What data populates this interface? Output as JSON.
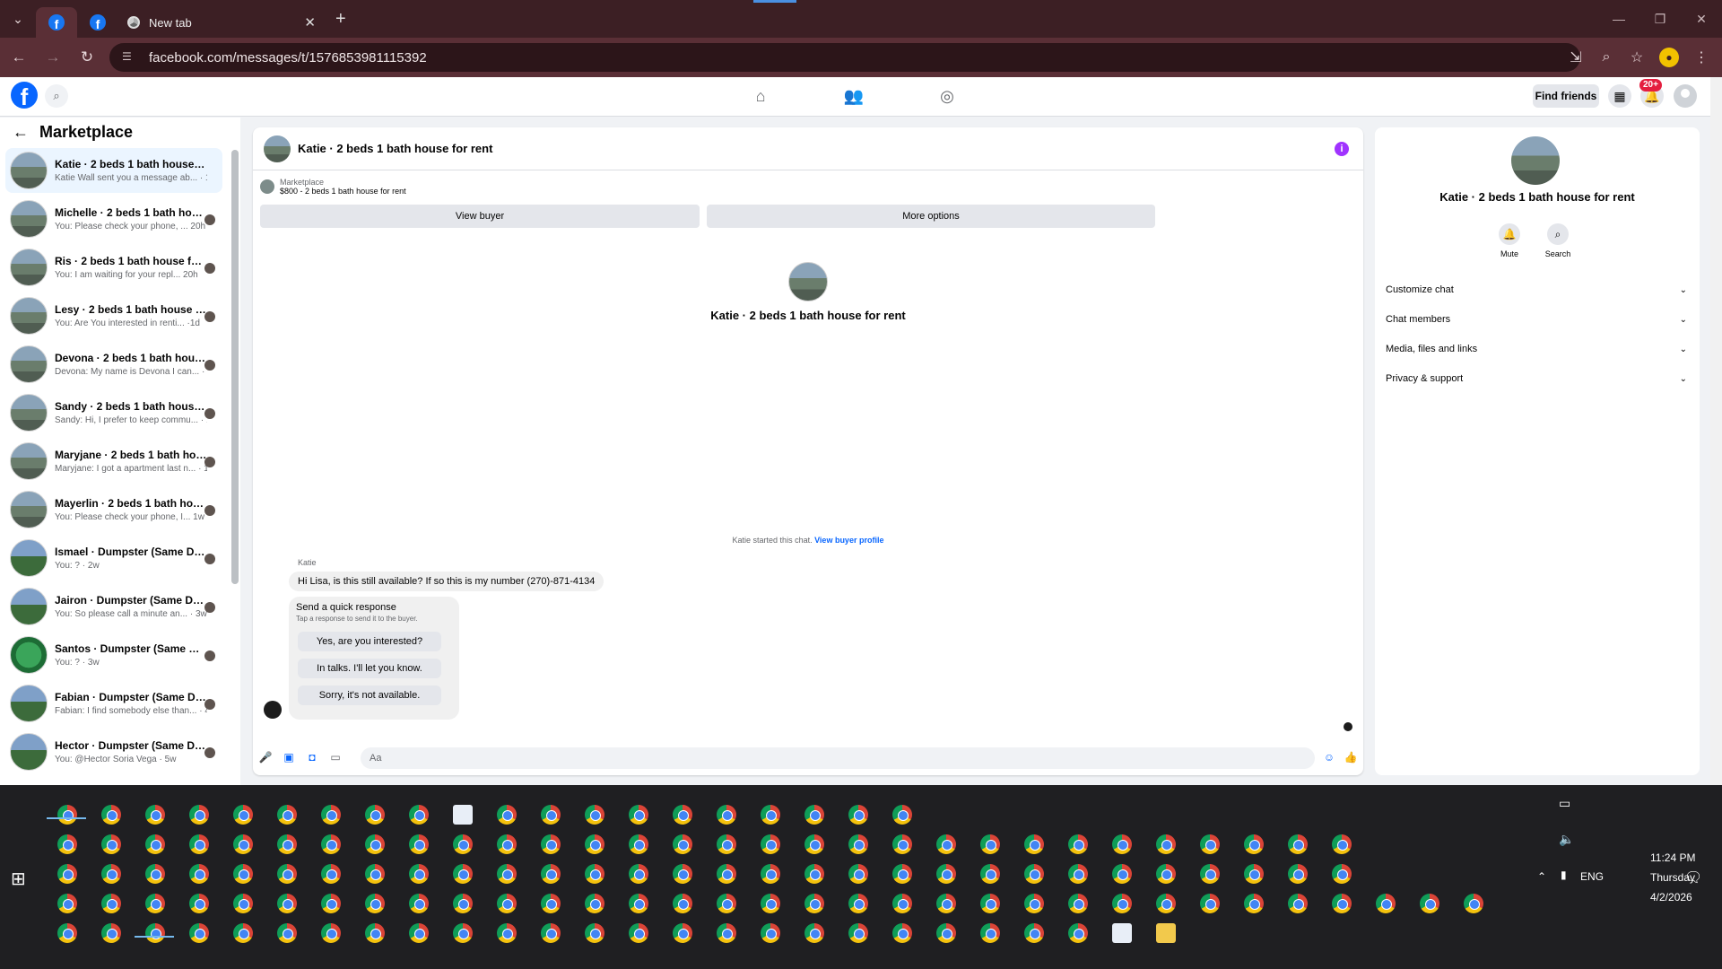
{
  "browser": {
    "new_tab_label": "New tab",
    "url": "facebook.com/messages/t/1576853981115392"
  },
  "header": {
    "find_friends_label": "Find friends",
    "notif_count": "20+"
  },
  "sidebar": {
    "title": "Marketplace",
    "conversations": [
      {
        "name": "Katie · 2 beds 1 bath house for r...",
        "preview": "Katie Wall sent you a message ab... · 19h"
      },
      {
        "name": "Michelle · 2 beds 1 bath hous...",
        "preview": "You: Please check your phone, ... 20h"
      },
      {
        "name": "Ris · 2 beds 1 bath house for ...",
        "preview": "You: I am waiting for your repl... 20h"
      },
      {
        "name": "Lesy · 2 beds 1 bath house fo...",
        "preview": "You: Are You interested in renti... ·1d"
      },
      {
        "name": "Devona · 2 beds 1 bath house f...",
        "preview": "Devona: My name is Devona I can... · 1w"
      },
      {
        "name": "Sandy · 2 beds 1 bath house for...",
        "preview": "Sandy: Hi, I prefer to keep commu... · 1w"
      },
      {
        "name": "Maryjane · 2 beds 1 bath house ...",
        "preview": "Maryjane: I got a apartment last n... · 1w"
      },
      {
        "name": "Mayerlin · 2 beds 1 bath hous...",
        "preview": "You: Please check your phone, I... 1w"
      },
      {
        "name": "Ismael · Dumpster (Same Day...",
        "preview": "You: ? · 2w"
      },
      {
        "name": "Jairon · Dumpster (Same Day...",
        "preview": "You: So please call a minute an... · 3w"
      },
      {
        "name": "Santos · Dumpster (Same Da...",
        "preview": "You: ? · 3w"
      },
      {
        "name": "Fabian · Dumpster (Same Day), ...",
        "preview": "Fabian: I find somebody else than... · 4w"
      },
      {
        "name": "Hector · Dumpster (Same Da...",
        "preview": "You: @Hector Soria Vega · 5w"
      }
    ]
  },
  "chat": {
    "title": "Katie · 2 beds 1 bath house for rent",
    "marketplace_label": "Marketplace",
    "listing": "$800 - 2 beds 1 bath house for rent",
    "view_buyer_label": "View buyer",
    "more_options_label": "More options",
    "center_title": "Katie · 2 beds 1 bath house for rent",
    "started_text": "Katie started this chat.",
    "view_profile_link": "View buyer profile",
    "sender_name": "Katie",
    "message": "Hi Lisa, is this still available? If so this is my number (270)-871-4134",
    "quick_title": "Send a quick response",
    "quick_sub": "Tap a response to send it to the buyer.",
    "quick_responses": [
      "Yes, are you interested?",
      "In talks. I'll let you know.",
      "Sorry, it's not available."
    ],
    "input_placeholder": "Aa"
  },
  "panel": {
    "title": "Katie · 2 beds 1 bath house for rent",
    "mute_label": "Mute",
    "search_label": "Search",
    "rows": [
      "Customize chat",
      "Chat members",
      "Media, files and links",
      "Privacy & support"
    ]
  },
  "taskbar": {
    "time": "11:24 PM",
    "day": "Thursday",
    "date": "4/2/2026",
    "lang": "ENG"
  }
}
